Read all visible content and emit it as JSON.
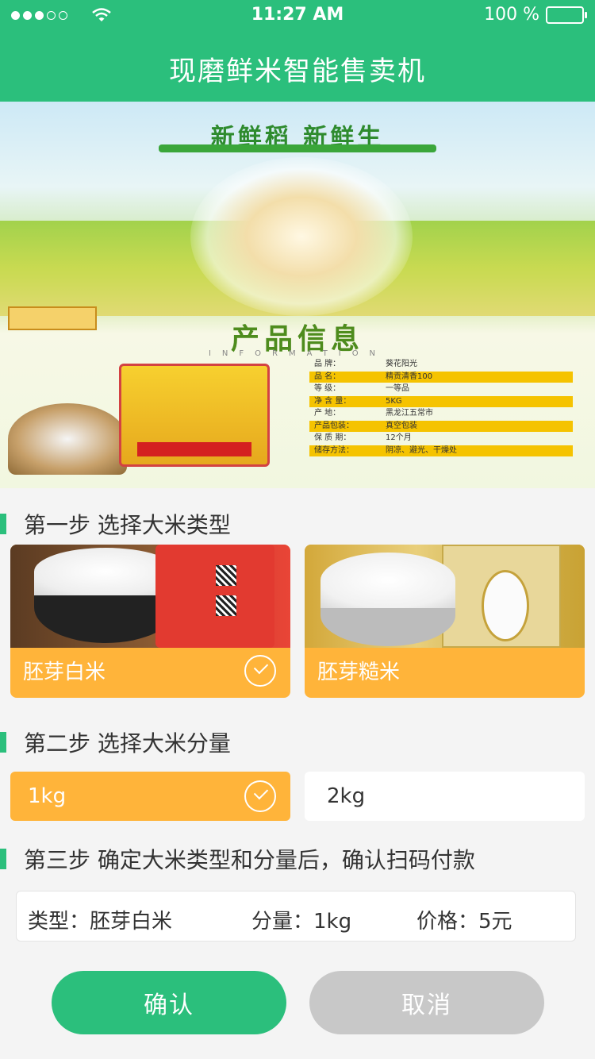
{
  "status": {
    "time": "11:27 AM",
    "battery": "100 %"
  },
  "header": {
    "title": "现磨鲜米智能售卖机"
  },
  "banner": {
    "slogan": "新鲜稻  新鲜生",
    "info_title": "产品信息",
    "info_sub": "INFORMATION",
    "info_rows": [
      {
        "k": "品      牌：",
        "v": "葵花阳光"
      },
      {
        "k": "品      名：",
        "v": "精贡清香100"
      },
      {
        "k": "等      级：",
        "v": "一等品"
      },
      {
        "k": "净  含  量：",
        "v": "5KG"
      },
      {
        "k": "产      地：",
        "v": "黑龙江五常市"
      },
      {
        "k": "产品包装：",
        "v": "真空包装"
      },
      {
        "k": "保  质  期：",
        "v": "12个月"
      },
      {
        "k": "储存方法：",
        "v": "阴凉、避光、干燥处"
      }
    ]
  },
  "step1": {
    "label": "第一步  选择大米类型"
  },
  "rice_types": [
    {
      "name": "胚芽白米",
      "selected": true
    },
    {
      "name": "胚芽糙米",
      "selected": false
    }
  ],
  "step2": {
    "label": "第二步  选择大米分量"
  },
  "weights": [
    {
      "value": "1kg",
      "selected": true
    },
    {
      "value": "2kg",
      "selected": false
    }
  ],
  "step3": {
    "label": "第三步  确定大米类型和分量后，确认扫码付款"
  },
  "summary": {
    "type": "类型：胚芽白米",
    "weight": "分量：1kg",
    "price": "价格：5元"
  },
  "buttons": {
    "confirm": "确认",
    "cancel": "取消"
  },
  "colors": {
    "accent": "#2bbf7c",
    "selected": "#ffb43a",
    "cancel": "#c8c8c8"
  }
}
